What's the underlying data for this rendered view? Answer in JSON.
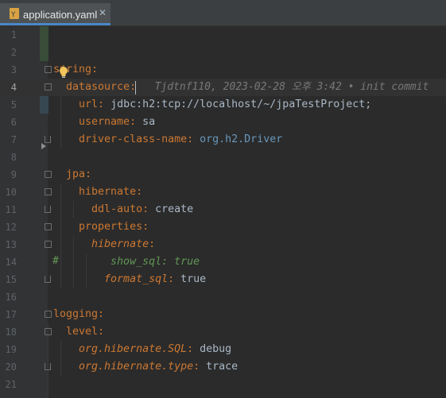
{
  "tab": {
    "filename": "application.yaml",
    "close_glyph": "✕",
    "icon": "yaml-file-icon"
  },
  "blame": "Tjdtnf110, 2023-02-28 오후 3:42 • init commit",
  "lines": [
    {
      "n": "1",
      "segments": []
    },
    {
      "n": "2",
      "segments": []
    },
    {
      "n": "3",
      "segments": [
        {
          "t": "spring",
          "c": "k"
        },
        {
          "t": ":",
          "c": "punct"
        }
      ]
    },
    {
      "n": "4",
      "segments": [
        {
          "t": "  datasource",
          "c": "k"
        },
        {
          "t": ":",
          "c": "punct"
        }
      ]
    },
    {
      "n": "5",
      "segments": [
        {
          "t": "    url",
          "c": "k"
        },
        {
          "t": ": ",
          "c": "punct"
        },
        {
          "t": "jdbc:h2:tcp://localhost/~/jpaTestProject;",
          "c": "val"
        }
      ]
    },
    {
      "n": "6",
      "segments": [
        {
          "t": "    username",
          "c": "k"
        },
        {
          "t": ": ",
          "c": "punct"
        },
        {
          "t": "sa",
          "c": "val"
        }
      ]
    },
    {
      "n": "7",
      "segments": [
        {
          "t": "    driver-class-name",
          "c": "k"
        },
        {
          "t": ": ",
          "c": "punct"
        },
        {
          "t": "org.h2.Driver",
          "c": "val-teal"
        }
      ]
    },
    {
      "n": "8",
      "segments": []
    },
    {
      "n": "9",
      "segments": [
        {
          "t": "  jpa",
          "c": "k"
        },
        {
          "t": ":",
          "c": "punct"
        }
      ]
    },
    {
      "n": "10",
      "segments": [
        {
          "t": "    hibernate",
          "c": "k"
        },
        {
          "t": ":",
          "c": "punct"
        }
      ]
    },
    {
      "n": "11",
      "segments": [
        {
          "t": "      ddl-auto",
          "c": "k"
        },
        {
          "t": ": ",
          "c": "punct"
        },
        {
          "t": "create",
          "c": "val"
        }
      ]
    },
    {
      "n": "12",
      "segments": [
        {
          "t": "    properties",
          "c": "k"
        },
        {
          "t": ":",
          "c": "punct"
        }
      ]
    },
    {
      "n": "13",
      "segments": [
        {
          "t": "      hibernate",
          "c": "kv-it"
        },
        {
          "t": ":",
          "c": "punct"
        }
      ]
    },
    {
      "n": "14",
      "segments": [
        {
          "t": "         show_sql: true",
          "c": "comment"
        }
      ]
    },
    {
      "n": "15",
      "segments": [
        {
          "t": "        format_sql",
          "c": "kv-it"
        },
        {
          "t": ": ",
          "c": "punct"
        },
        {
          "t": "true",
          "c": "val"
        }
      ]
    },
    {
      "n": "16",
      "segments": []
    },
    {
      "n": "17",
      "segments": [
        {
          "t": "logging",
          "c": "k"
        },
        {
          "t": ":",
          "c": "punct"
        }
      ]
    },
    {
      "n": "18",
      "segments": [
        {
          "t": "  level",
          "c": "k"
        },
        {
          "t": ":",
          "c": "punct"
        }
      ]
    },
    {
      "n": "19",
      "segments": [
        {
          "t": "    org.hibernate.SQL",
          "c": "kv-it"
        },
        {
          "t": ": ",
          "c": "punct"
        },
        {
          "t": "debug",
          "c": "val"
        }
      ]
    },
    {
      "n": "20",
      "segments": [
        {
          "t": "    org.hibernate.type",
          "c": "kv-it"
        },
        {
          "t": ": ",
          "c": "punct"
        },
        {
          "t": "trace",
          "c": "val"
        }
      ]
    },
    {
      "n": "21",
      "segments": []
    }
  ],
  "comment_marker": "#",
  "current_line": "4",
  "colors": {
    "background": "#2b2b2b",
    "gutter": "#313335",
    "key": "#cc7832",
    "value": "#a9b7c6",
    "comment": "#629755",
    "tab_accent": "#4a88c7"
  }
}
